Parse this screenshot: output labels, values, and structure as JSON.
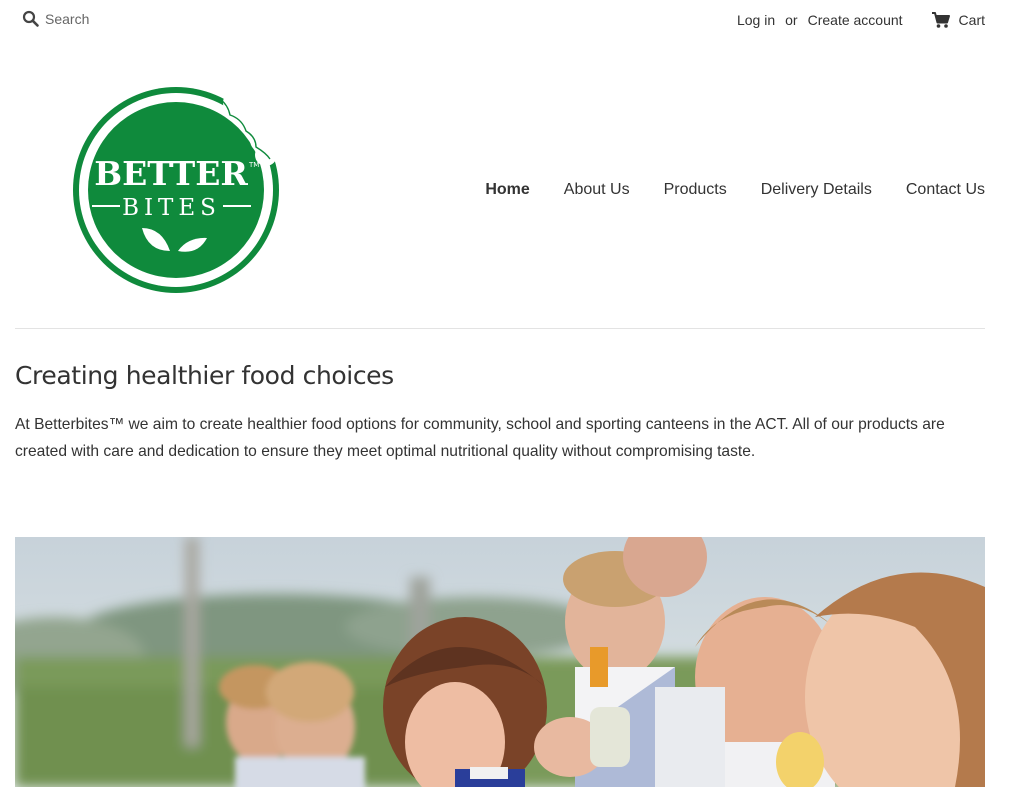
{
  "topbar": {
    "search_placeholder": "Search",
    "login": "Log in",
    "or": "or",
    "create_account": "Create account",
    "cart": "Cart"
  },
  "logo": {
    "line1": "BETTER",
    "line2": "BITES",
    "tm": "TM",
    "icon": "leaf-icon",
    "brand_color": "#0f8a3c"
  },
  "nav": {
    "items": [
      "Home",
      "About Us",
      "Products",
      "Delivery Details",
      "Contact Us"
    ],
    "active": "Home"
  },
  "main": {
    "title": "Creating healthier food choices",
    "intro": "At Betterbites™ we aim to create healthier food options for community, school and sporting canteens in the ACT. All of our products are created with care and dedication to ensure they meet optimal nutritional quality without compromising taste."
  }
}
